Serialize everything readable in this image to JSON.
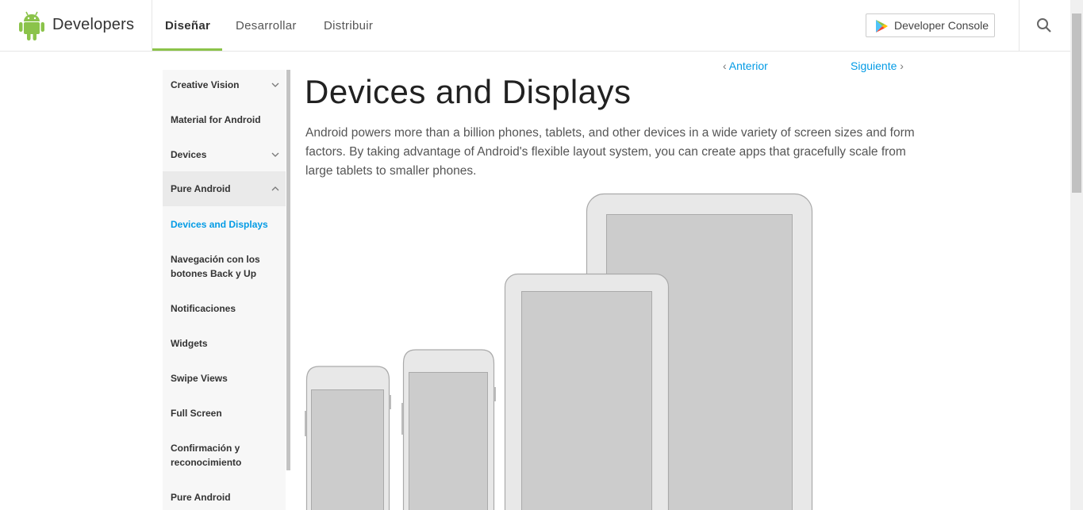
{
  "header": {
    "brand": "Developers",
    "tabs": [
      {
        "label": "Diseñar",
        "active": true
      },
      {
        "label": "Desarrollar",
        "active": false
      },
      {
        "label": "Distribuir",
        "active": false
      }
    ],
    "console_button": "Developer Console",
    "icons": [
      "android-logo-icon",
      "play-store-icon",
      "search-icon"
    ],
    "accent_color": "#8bc34a"
  },
  "sidebar": {
    "items": [
      {
        "label": "Creative Vision",
        "expandable": true,
        "expanded": false
      },
      {
        "label": "Material for Android",
        "expandable": false
      },
      {
        "label": "Devices",
        "expandable": true,
        "expanded": false
      },
      {
        "label": "Pure Android",
        "expandable": true,
        "expanded": true
      },
      {
        "label": "Devices and Displays",
        "current": true
      },
      {
        "label": "Navegación con los botones Back y Up"
      },
      {
        "label": "Notificaciones"
      },
      {
        "label": "Widgets"
      },
      {
        "label": "Swipe Views"
      },
      {
        "label": "Full Screen"
      },
      {
        "label": "Confirmación y reconocimiento"
      },
      {
        "label": "Pure Android"
      }
    ],
    "current_color": "#039be5"
  },
  "main": {
    "prev": "Anterior",
    "next": "Siguiente",
    "title": "Devices and Displays",
    "intro": "Android powers more than a billion phones, tablets, and other devices in a wide variety of screen sizes and form factors. By taking advantage of Android's flexible layout system, you can create apps that gracefully scale from large tablets to smaller phones."
  }
}
